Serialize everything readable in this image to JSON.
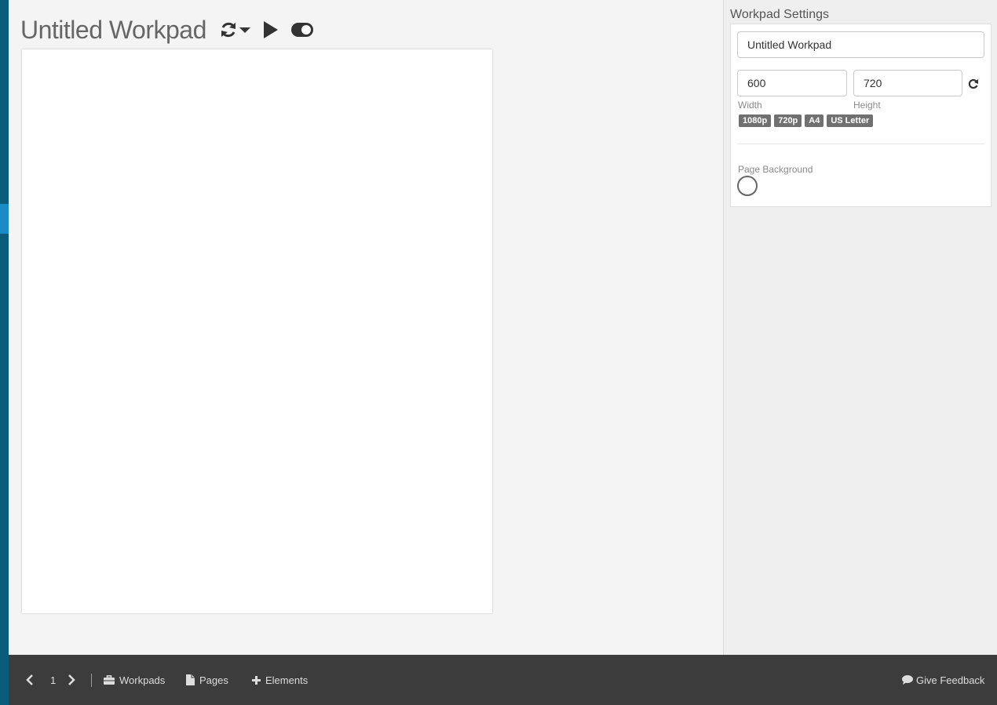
{
  "header": {
    "title": "Untitled Workpad",
    "icons": {
      "refresh": "refresh-icon",
      "dropdown": "caret-down-icon",
      "play": "play-icon",
      "toggle": "toggle-icon"
    }
  },
  "sidebar": {
    "title": "Workpad Settings",
    "name_value": "Untitled Workpad",
    "width_value": "600",
    "height_value": "720",
    "width_label": "Width",
    "height_label": "Height",
    "presets": [
      "1080p",
      "720p",
      "A4",
      "US Letter"
    ],
    "background_label": "Page Background",
    "background_color": "#ffffff"
  },
  "footer": {
    "page_number": "1",
    "workpads_label": "Workpads",
    "pages_label": "Pages",
    "elements_label": "Elements",
    "feedback_label": "Give Feedback"
  },
  "colors": {
    "nav_bar": "#0b5b7a",
    "nav_active": "#1a8bc6",
    "footer_bg": "#3c3c3c",
    "workspace_bg": "#f4f4f4"
  }
}
